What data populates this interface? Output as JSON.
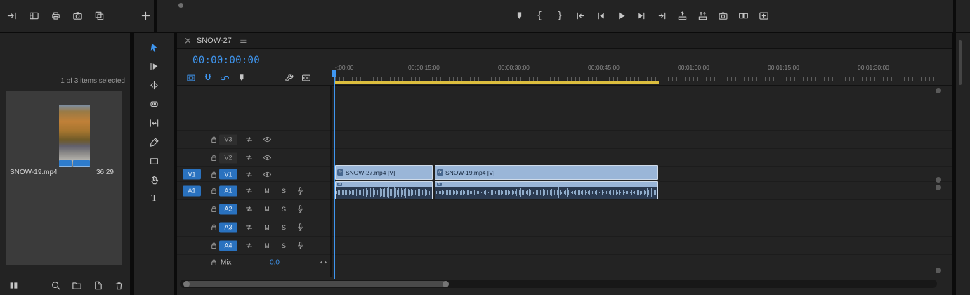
{
  "colors": {
    "accent_blue": "#3f96f0",
    "track_target_blue": "#2a72bf",
    "video_clip_fill": "#9ab6d8",
    "audio_clip_fill": "#2b3a50",
    "waveform": "#8fabc9",
    "work_area_yellow": "#dcbe3e",
    "panel_background": "#232323"
  },
  "top_bar": {
    "left_icons": [
      "send-to",
      "panels",
      "printer",
      "camera",
      "duplicate"
    ],
    "transport_icons": [
      "add-marker",
      "mark-in",
      "mark-out",
      "go-to-in",
      "step-back",
      "play",
      "step-forward",
      "go-to-out",
      "lift",
      "extract",
      "export-frame",
      "comparison-view",
      "button-editor"
    ]
  },
  "project_panel": {
    "selection_status": "1 of 3 items selected",
    "item": {
      "name": "SNOW-19.mp4",
      "duration": "36:29"
    },
    "footer_icons": [
      "icon-view",
      "zoom",
      "new-bin",
      "new-item",
      "delete"
    ]
  },
  "tools": [
    {
      "name": "selection-tool",
      "icon": "tool-select",
      "active": true
    },
    {
      "name": "track-select-forward-tool",
      "icon": "tool-track-select"
    },
    {
      "name": "ripple-edit-tool",
      "icon": "tool-ripple"
    },
    {
      "name": "razor-tool",
      "icon": "tool-razor"
    },
    {
      "name": "slip-tool",
      "icon": "tool-slip"
    },
    {
      "name": "pen-tool",
      "icon": "tool-pen"
    },
    {
      "name": "rectangle-tool",
      "icon": "tool-rect"
    },
    {
      "name": "hand-tool",
      "icon": "tool-hand"
    },
    {
      "name": "type-tool",
      "glyph": "T"
    }
  ],
  "timeline": {
    "tab_label": "SNOW-27",
    "timecode": "00:00:00:00",
    "toolbar_icons": [
      {
        "name": "insert-as-nest",
        "icon": "nest",
        "active": true
      },
      {
        "name": "snap",
        "icon": "snap",
        "active": true
      },
      {
        "name": "linked-selection",
        "icon": "linked-selection",
        "active": true
      },
      {
        "name": "add-marker",
        "icon": "add-marker",
        "active": false
      },
      {
        "name": "timeline-settings",
        "icon": "wrench",
        "active": false
      },
      {
        "name": "captions",
        "icon": "captions",
        "active": false
      }
    ],
    "ruler_labels": [
      "-:00:00",
      "00:00:15:00",
      "00:00:30:00",
      "00:00:45:00",
      "00:01:00:00",
      "00:01:15:00",
      "00:01:30:00"
    ],
    "video_tracks": [
      {
        "name": "V3",
        "source": "",
        "targeted": false
      },
      {
        "name": "V2",
        "source": "",
        "targeted": false
      },
      {
        "name": "V1",
        "source": "V1",
        "targeted": true
      }
    ],
    "audio_tracks": [
      {
        "name": "A1",
        "source": "A1",
        "targeted": true
      },
      {
        "name": "A2",
        "source": "",
        "targeted": true
      },
      {
        "name": "A3",
        "source": "",
        "targeted": true
      },
      {
        "name": "A4",
        "source": "",
        "targeted": true
      }
    ],
    "audio_buttons": [
      "M",
      "S"
    ],
    "mix_track": {
      "name": "Mix",
      "value": "0.0"
    },
    "fx_badge": "fx",
    "video_clips": [
      {
        "name": "SNOW-27.mp4 [V]"
      },
      {
        "name": "SNOW-19.mp4 [V]"
      }
    ]
  }
}
